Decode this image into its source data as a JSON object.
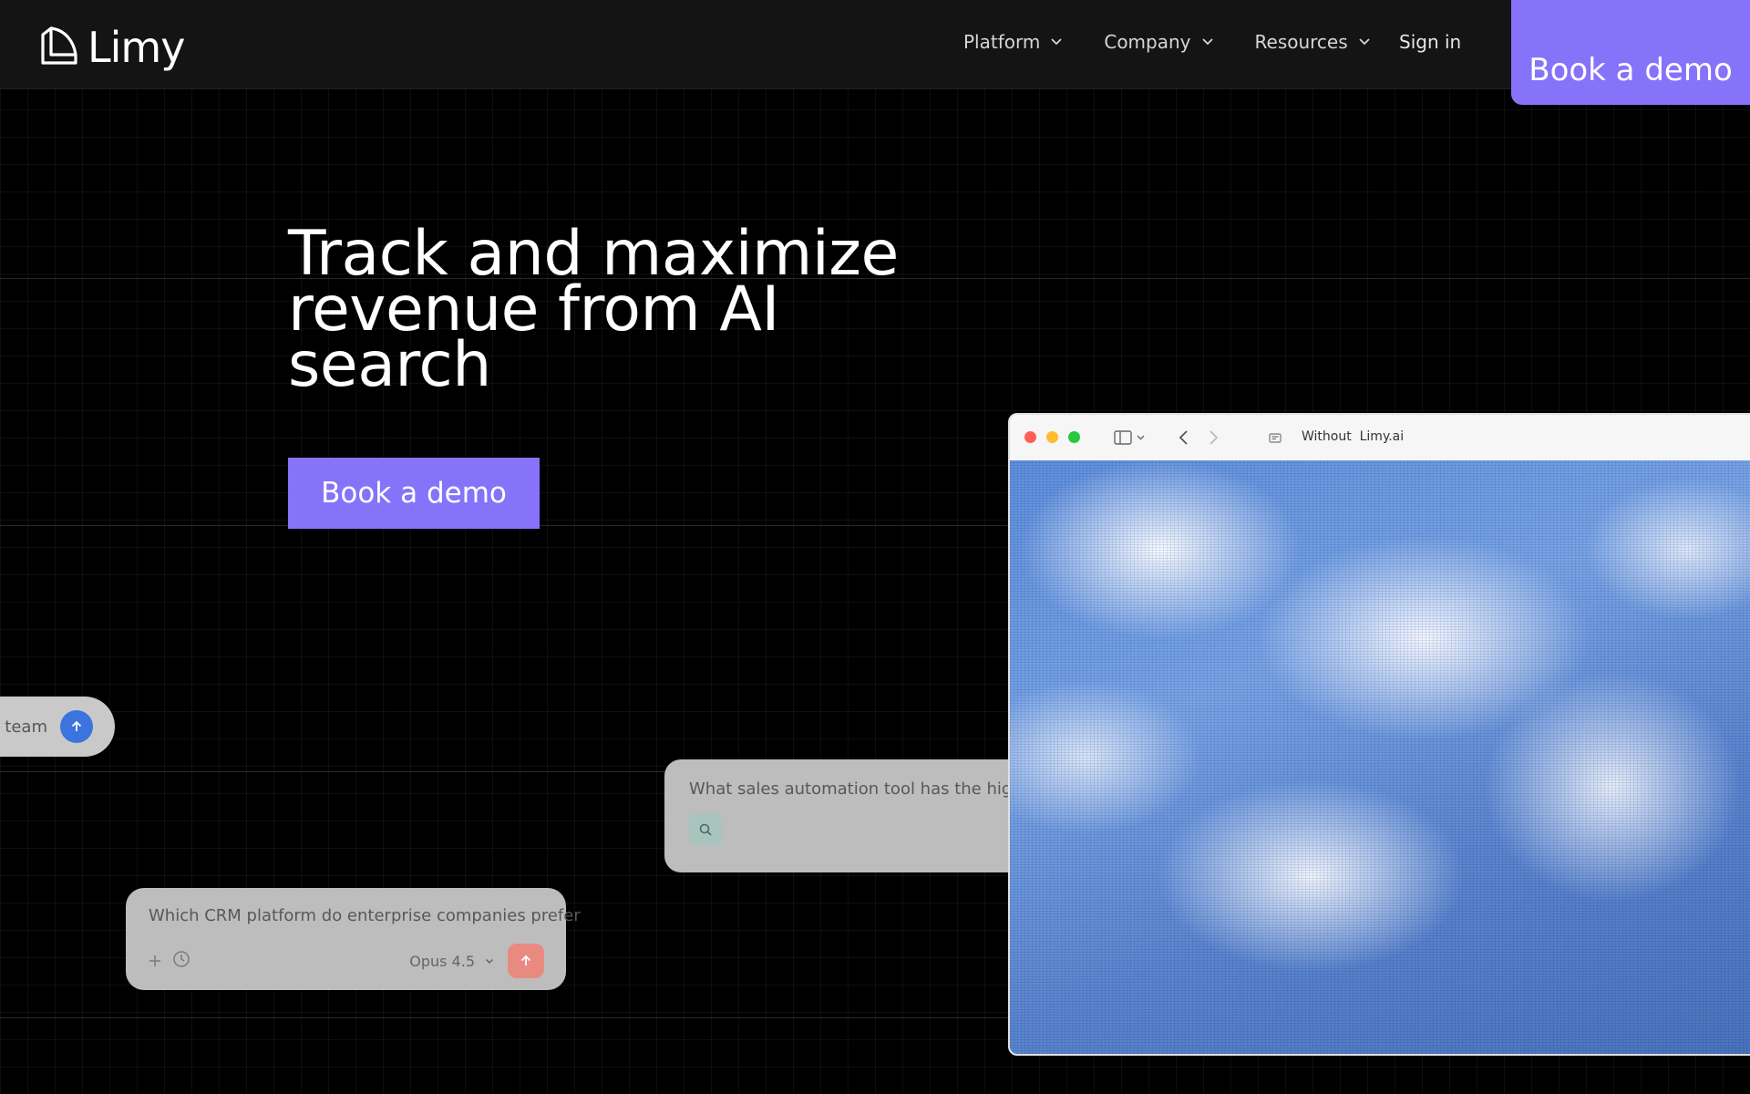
{
  "nav": {
    "logo_text": "Limy",
    "items": [
      {
        "label": "Platform"
      },
      {
        "label": "Company"
      },
      {
        "label": "Resources"
      }
    ],
    "signin_label": "Sign in",
    "cta_label": "Book a demo"
  },
  "hero": {
    "title": "Track and maximize revenue from AI search",
    "cta_label": "Book a demo"
  },
  "chat_cards": {
    "left_chip_text": "s team",
    "middle_query": "What sales automation tool has the highe",
    "lower_query": "Which CRM platform do enterprise companies prefer",
    "model_label": "Opus 4.5"
  },
  "browser": {
    "address_text": "Without  Limy.ai"
  },
  "colors": {
    "accent": "#8673fa",
    "background": "#000000",
    "send_blue": "#3b74de",
    "send_red": "#e98a80"
  }
}
